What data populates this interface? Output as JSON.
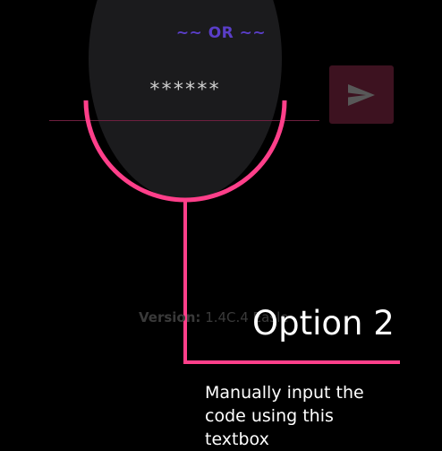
{
  "divider": {
    "label": "~~ OR ~~"
  },
  "code_entry": {
    "value": "",
    "placeholder": "******"
  },
  "send_button": {
    "icon": "send-icon"
  },
  "footer": {
    "version_label": "Version:",
    "version_value": "1.4C.4 Easle"
  },
  "annotation": {
    "title": "Option 2",
    "description": "Manually input the code using this textbox"
  },
  "colors": {
    "background": "#000000",
    "accent_pink": "#ff3f8a",
    "divider_purple": "#5a3ec8",
    "send_button_bg": "#3d1220",
    "spotlight": "#1b1b1d"
  }
}
